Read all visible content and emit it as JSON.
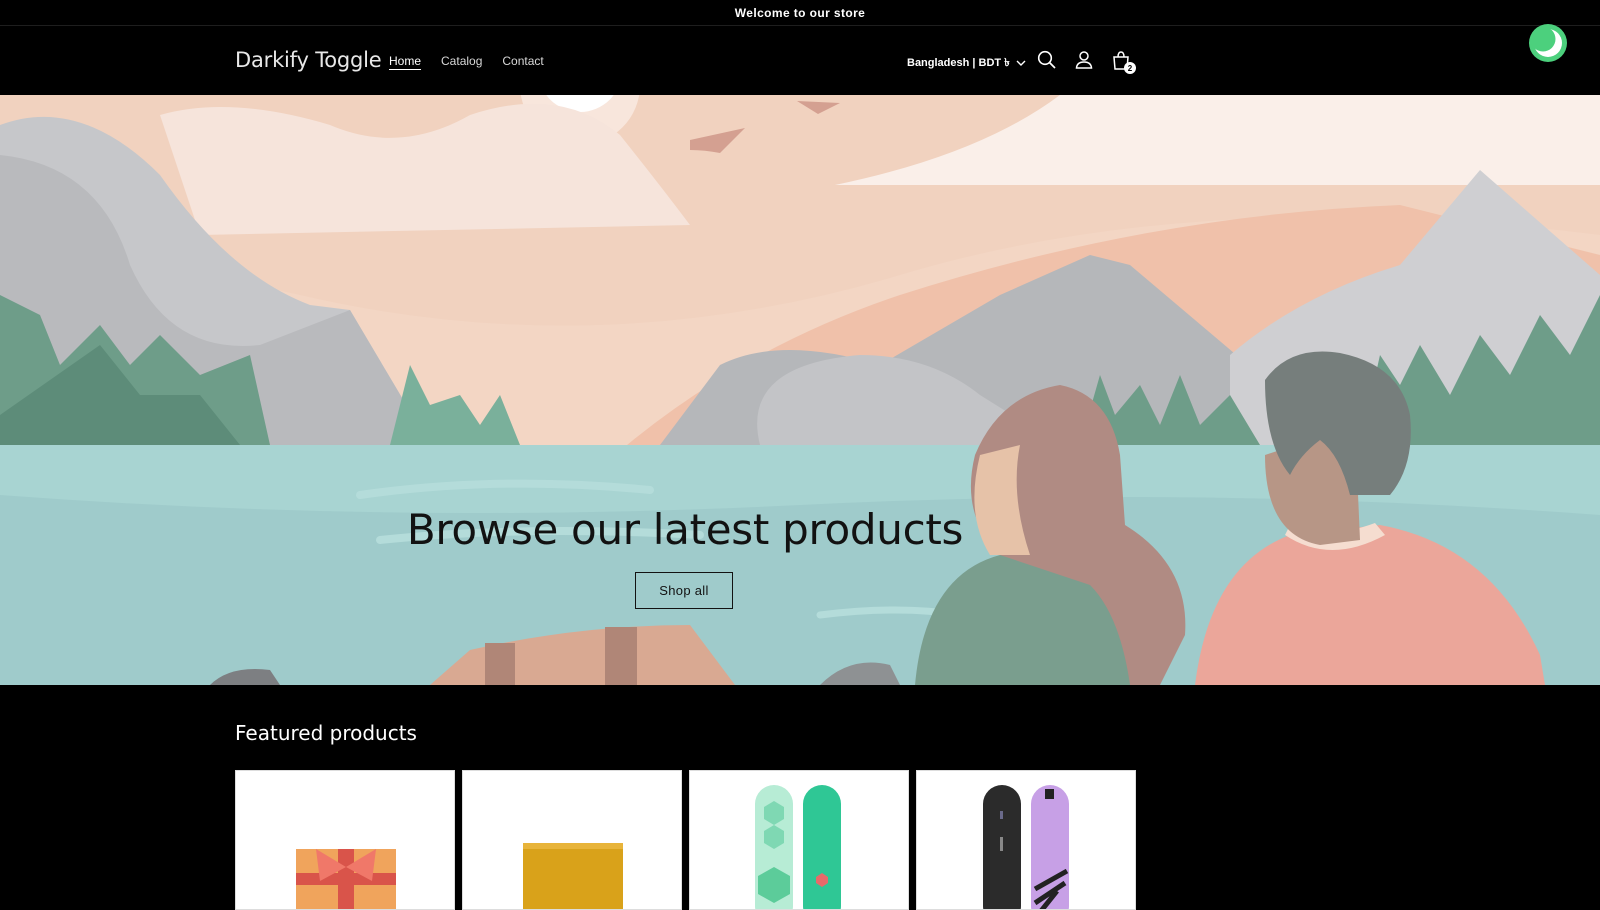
{
  "announcement": {
    "text": "Welcome to our store"
  },
  "header": {
    "logo": "Darkify Toggle",
    "nav": [
      {
        "label": "Home",
        "active": true
      },
      {
        "label": "Catalog",
        "active": false
      },
      {
        "label": "Contact",
        "active": false
      }
    ],
    "country_selector": "Bangladesh | BDT ৳",
    "icons": [
      "search-icon",
      "account-icon",
      "cart-icon",
      "chevron-down-icon"
    ],
    "cart_count": "2"
  },
  "dark_mode_toggle": {
    "icon": "moon-icon",
    "color": "#4cd07d"
  },
  "hero": {
    "title": "Browse our latest products",
    "button_label": "Shop all"
  },
  "featured": {
    "title": "Featured products",
    "products": [
      {
        "icon": "gift-card-image"
      },
      {
        "icon": "wax-bar-image"
      },
      {
        "icon": "green-snowboard-image"
      },
      {
        "icon": "purple-snowboard-image"
      }
    ]
  }
}
